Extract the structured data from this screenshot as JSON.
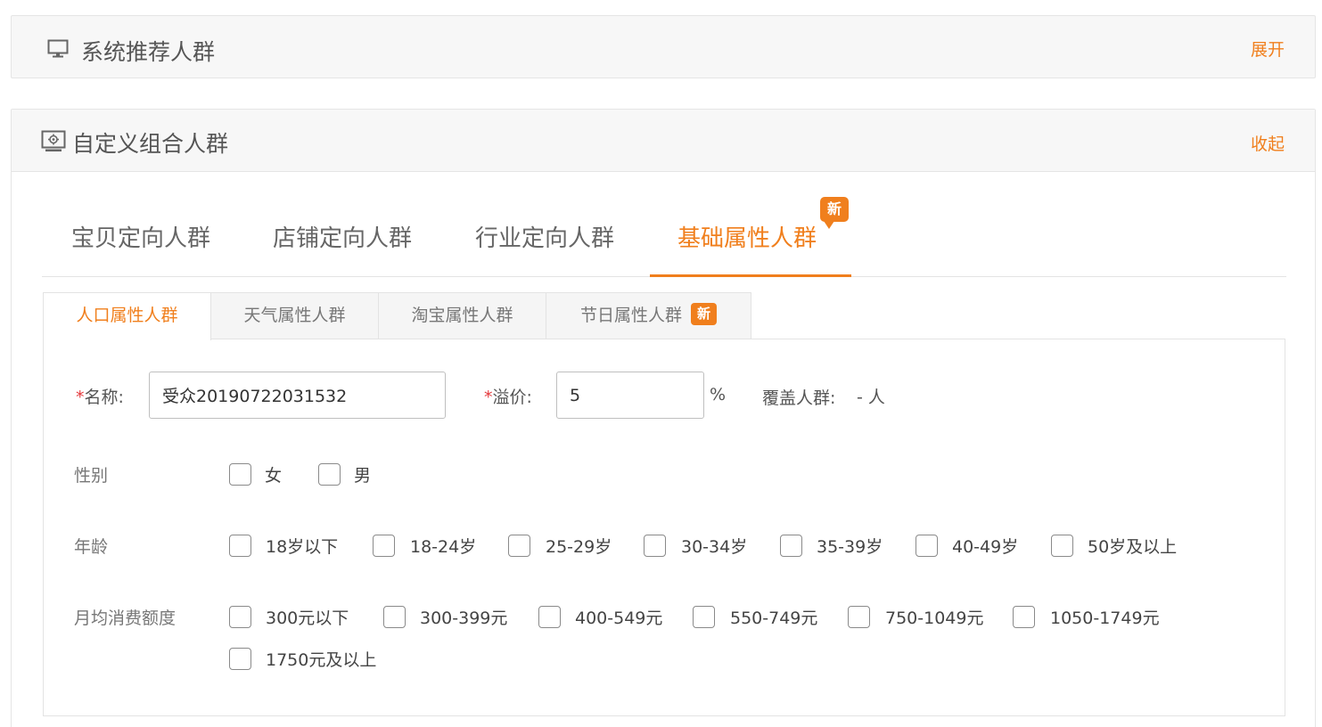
{
  "system_panel": {
    "icon": "monitor-icon",
    "title": "系统推荐人群",
    "action": "展开"
  },
  "custom_panel": {
    "icon": "screen-cog-icon",
    "title": "自定义组合人群",
    "action": "收起"
  },
  "main_tabs": [
    {
      "label": "宝贝定向人群"
    },
    {
      "label": "店铺定向人群"
    },
    {
      "label": "行业定向人群"
    },
    {
      "label": "基础属性人群"
    }
  ],
  "main_tab_badge": "新",
  "sub_tabs": [
    {
      "label": "人口属性人群"
    },
    {
      "label": "天气属性人群"
    },
    {
      "label": "淘宝属性人群"
    },
    {
      "label": "节日属性人群"
    }
  ],
  "sub_tab_badge": "新",
  "form": {
    "required_mark": "*",
    "name_label": "名称:",
    "name_value": "受众20190722031532",
    "premium_label": "溢价:",
    "premium_value": "5",
    "premium_unit": "%",
    "coverage_label": "覆盖人群:",
    "coverage_value": "- 人"
  },
  "gender": {
    "label": "性别",
    "options": [
      "女",
      "男"
    ]
  },
  "age": {
    "label": "年龄",
    "options": [
      "18岁以下",
      "18-24岁",
      "25-29岁",
      "30-34岁",
      "35-39岁",
      "40-49岁",
      "50岁及以上"
    ]
  },
  "spending": {
    "label": "月均消费额度",
    "options": [
      "300元以下",
      "300-399元",
      "400-549元",
      "550-749元",
      "750-1049元",
      "1050-1749元",
      "1750元及以上"
    ]
  },
  "colors": {
    "accent": "#f07f1d",
    "required": "#e4393c"
  }
}
